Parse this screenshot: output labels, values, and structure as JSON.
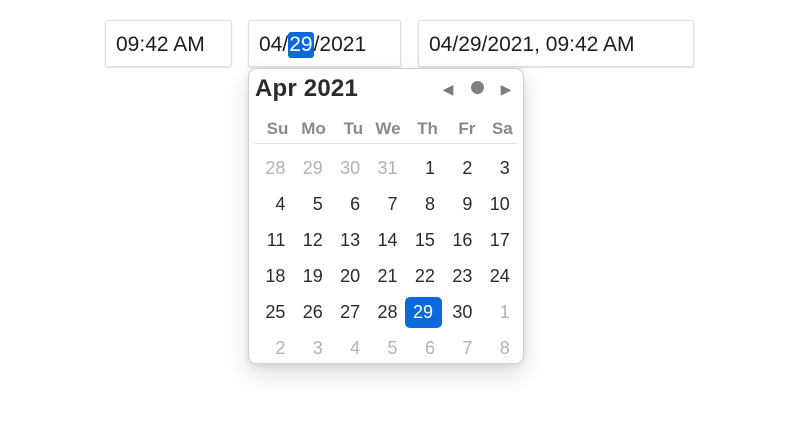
{
  "fields": {
    "time": "09:42 AM",
    "date": {
      "month": "04",
      "day": "29",
      "year": "2021",
      "sep": "/"
    },
    "datetime": "04/29/2021, 09:42 AM"
  },
  "picker": {
    "header": "Apr 2021",
    "nav": {
      "prev": "◀",
      "next": "▶"
    },
    "weekdays": [
      "Su",
      "Mo",
      "Tu",
      "We",
      "Th",
      "Fr",
      "Sa"
    ],
    "weeks": [
      [
        {
          "d": "28",
          "o": true
        },
        {
          "d": "29",
          "o": true
        },
        {
          "d": "30",
          "o": true
        },
        {
          "d": "31",
          "o": true
        },
        {
          "d": "1"
        },
        {
          "d": "2"
        },
        {
          "d": "3"
        }
      ],
      [
        {
          "d": "4"
        },
        {
          "d": "5"
        },
        {
          "d": "6"
        },
        {
          "d": "7"
        },
        {
          "d": "8"
        },
        {
          "d": "9"
        },
        {
          "d": "10"
        }
      ],
      [
        {
          "d": "11"
        },
        {
          "d": "12"
        },
        {
          "d": "13"
        },
        {
          "d": "14"
        },
        {
          "d": "15"
        },
        {
          "d": "16"
        },
        {
          "d": "17"
        }
      ],
      [
        {
          "d": "18"
        },
        {
          "d": "19"
        },
        {
          "d": "20"
        },
        {
          "d": "21"
        },
        {
          "d": "22"
        },
        {
          "d": "23"
        },
        {
          "d": "24"
        }
      ],
      [
        {
          "d": "25"
        },
        {
          "d": "26"
        },
        {
          "d": "27"
        },
        {
          "d": "28"
        },
        {
          "d": "29",
          "s": true
        },
        {
          "d": "30"
        },
        {
          "d": "1",
          "o": true
        }
      ],
      [
        {
          "d": "2",
          "o": true
        },
        {
          "d": "3",
          "o": true
        },
        {
          "d": "4",
          "o": true
        },
        {
          "d": "5",
          "o": true
        },
        {
          "d": "6",
          "o": true
        },
        {
          "d": "7",
          "o": true
        },
        {
          "d": "8",
          "o": true
        }
      ]
    ]
  },
  "colors": {
    "selection": "#0b69d9",
    "muted_day": "#b3b3b3",
    "weekday_header": "#8a8a8a"
  }
}
